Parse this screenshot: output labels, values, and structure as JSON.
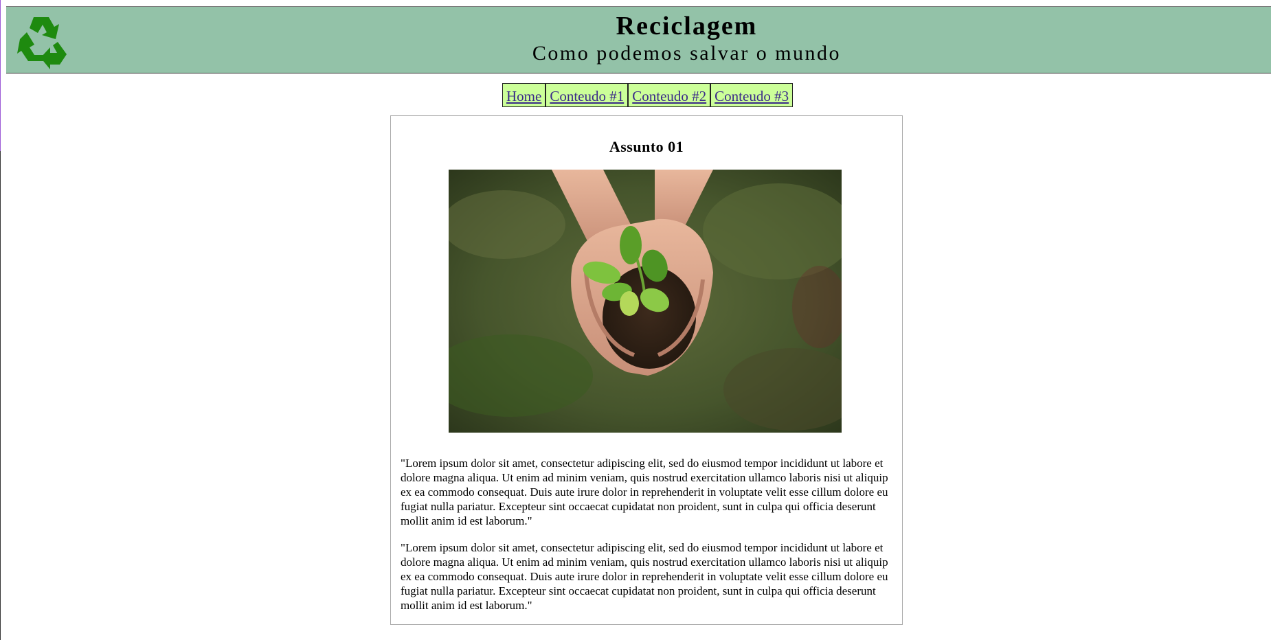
{
  "header": {
    "title": "Reciclagem",
    "subtitle": "Como podemos salvar o mundo",
    "logo_icon": "recycle-icon",
    "background": "#93c2a8",
    "logo_color": "#1e8a0f"
  },
  "nav": {
    "items": [
      {
        "label": "Home "
      },
      {
        "label": "Conteudo #1 "
      },
      {
        "label": "Conteudo #2 "
      },
      {
        "label": "Conteudo #3"
      }
    ],
    "background": "#ccff99",
    "link_color": "#3a2a88"
  },
  "article": {
    "title": "Assunto 01",
    "image_icon": "seedling-in-hands-image",
    "paragraphs": [
      "\"Lorem ipsum dolor sit amet, consectetur adipiscing elit, sed do eiusmod tempor incididunt ut labore et dolore magna aliqua. Ut enim ad minim veniam, quis nostrud exercitation ullamco laboris nisi ut aliquip ex ea commodo consequat. Duis aute irure dolor in reprehenderit in voluptate velit esse cillum dolore eu fugiat nulla pariatur. Excepteur sint occaecat cupidatat non proident, sunt in culpa qui officia deserunt mollit anim id est laborum.\"",
      "\"Lorem ipsum dolor sit amet, consectetur adipiscing elit, sed do eiusmod tempor incididunt ut labore et dolore magna aliqua. Ut enim ad minim veniam, quis nostrud exercitation ullamco laboris nisi ut aliquip ex ea commodo consequat. Duis aute irure dolor in reprehenderit in voluptate velit esse cillum dolore eu fugiat nulla pariatur. Excepteur sint occaecat cupidatat non proident, sunt in culpa qui officia deserunt mollit anim id est laborum.\""
    ]
  }
}
